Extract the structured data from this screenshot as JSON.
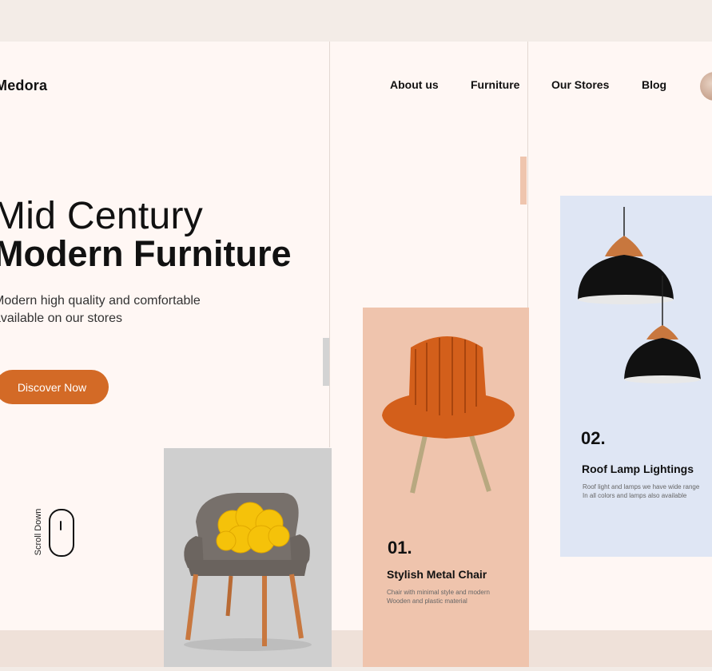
{
  "brand": {
    "name": "Medora"
  },
  "nav": {
    "items": [
      {
        "label": "About us"
      },
      {
        "label": "Furniture"
      },
      {
        "label": "Our Stores"
      },
      {
        "label": "Blog"
      }
    ]
  },
  "hero": {
    "title_line1": "Mid Century",
    "title_line2": "Modern Furniture",
    "subtitle_line1": "Modern high quality and comfortable",
    "subtitle_line2": "available on our stores",
    "cta_label": "Discover Now"
  },
  "scroll": {
    "label": "Scroll Down"
  },
  "cards": [
    {
      "number": "01.",
      "title": "Stylish Metal Chair",
      "desc_line1": "Chair with minimal style and modern",
      "desc_line2": "Wooden and plastic material"
    },
    {
      "number": "02.",
      "title": "Roof Lamp Lightings",
      "desc_line1": "Roof light and lamps we have wide range",
      "desc_line2": "In all colors and lamps also available"
    }
  ],
  "colors": {
    "accent": "#d36a26",
    "page_bg": "#fff7f4",
    "card_peach": "#efc4ad",
    "card_blue": "#dfe6f4",
    "card_grey": "#cfcfcf"
  },
  "icons": {
    "mouse": "mouse-scroll-icon",
    "avatar": "user-avatar"
  }
}
